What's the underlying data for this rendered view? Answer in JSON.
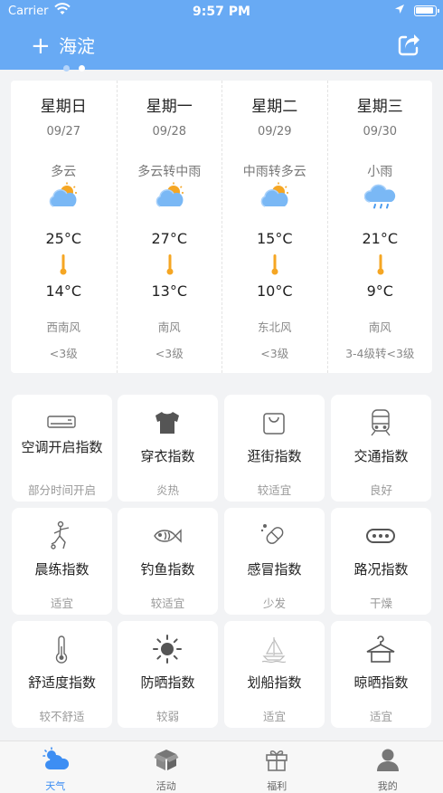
{
  "status_bar": {
    "carrier": "Carrier",
    "time": "9:57 PM"
  },
  "header": {
    "add_symbol": "+",
    "city": "海淀"
  },
  "forecast": [
    {
      "weekday": "星期日",
      "date": "09/27",
      "condition": "多云",
      "icon": "partly-cloudy-icon",
      "high": "25°C",
      "low": "14°C",
      "wind": "西南风",
      "level": "<3级"
    },
    {
      "weekday": "星期一",
      "date": "09/28",
      "condition": "多云转中雨",
      "icon": "partly-cloudy-icon",
      "high": "27°C",
      "low": "13°C",
      "wind": "南风",
      "level": "<3级"
    },
    {
      "weekday": "星期二",
      "date": "09/29",
      "condition": "中雨转多云",
      "icon": "partly-cloudy-icon",
      "high": "15°C",
      "low": "10°C",
      "wind": "东北风",
      "level": "<3级"
    },
    {
      "weekday": "星期三",
      "date": "09/30",
      "condition": "小雨",
      "icon": "light-rain-icon",
      "high": "21°C",
      "low": "9°C",
      "wind": "南风",
      "level": "3-4级转<3级"
    }
  ],
  "indices": [
    {
      "title": "空调开启指数",
      "value": "部分时间开启",
      "icon": "air-conditioner-icon"
    },
    {
      "title": "穿衣指数",
      "value": "炎热",
      "icon": "tshirt-icon"
    },
    {
      "title": "逛街指数",
      "value": "较适宜",
      "icon": "shopping-bag-icon"
    },
    {
      "title": "交通指数",
      "value": "良好",
      "icon": "train-icon"
    },
    {
      "title": "晨练指数",
      "value": "适宜",
      "icon": "exercise-icon"
    },
    {
      "title": "钓鱼指数",
      "value": "较适宜",
      "icon": "fish-icon"
    },
    {
      "title": "感冒指数",
      "value": "少发",
      "icon": "pill-icon"
    },
    {
      "title": "路况指数",
      "value": "干燥",
      "icon": "road-icon"
    },
    {
      "title": "舒适度指数",
      "value": "较不舒适",
      "icon": "thermometer-icon"
    },
    {
      "title": "防晒指数",
      "value": "较弱",
      "icon": "sun-icon"
    },
    {
      "title": "划船指数",
      "value": "适宜",
      "icon": "sailboat-icon"
    },
    {
      "title": "晾晒指数",
      "value": "适宜",
      "icon": "hanger-icon"
    }
  ],
  "tabs": [
    {
      "label": "天气",
      "icon": "weather-icon",
      "active": true
    },
    {
      "label": "活动",
      "icon": "box-icon",
      "active": false
    },
    {
      "label": "福利",
      "icon": "gift-icon",
      "active": false
    },
    {
      "label": "我的",
      "icon": "user-icon",
      "active": false
    }
  ],
  "colors": {
    "header_bg": "#68aaf4",
    "accent": "#3d8ef3",
    "sun": "#f5a623",
    "cloud": "#7ab8f5"
  }
}
